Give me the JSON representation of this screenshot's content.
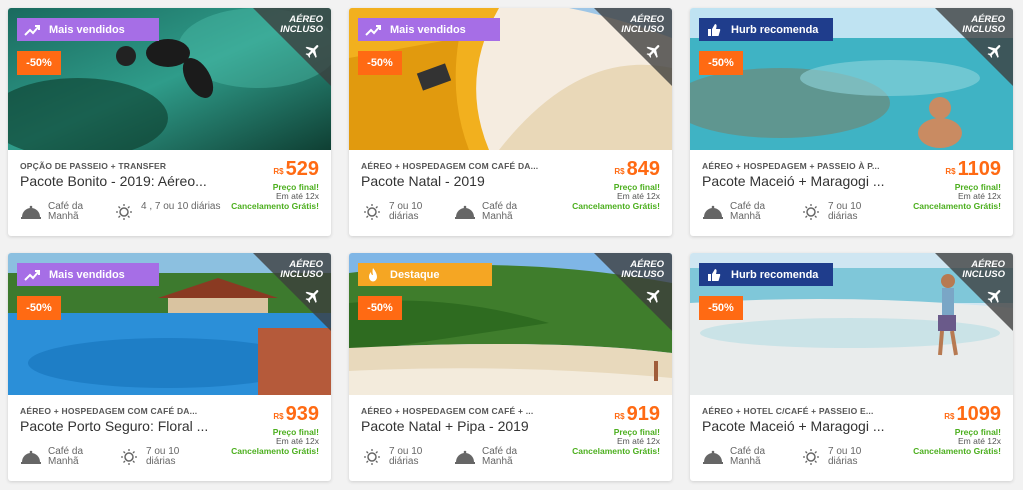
{
  "common": {
    "aereo_line1": "AÉREO",
    "aereo_line2": "INCLUSO",
    "currency": "R$",
    "final_label": "Preço final!",
    "install_label": "Em até 12x",
    "cancel_label": "Cancelamento Grátis!",
    "discount": "-50%",
    "feature_breakfast": "Café da Manhã",
    "colors": {
      "orange": "#ff6a13",
      "green": "#4caf1e",
      "purple": "#a66ee6",
      "navy": "#1f3d8c",
      "yellow": "#f5a623"
    }
  },
  "cards": [
    {
      "tag_label": "Mais vendidos",
      "tag_icon": "trending-up-icon",
      "category": "OPÇÃO DE PASSEIO + TRANSFER",
      "title": "Pacote Bonito - 2019: Aéreo...",
      "price": "529",
      "diarias": "4 , 7 ou 10 diárias"
    },
    {
      "tag_label": "Mais vendidos",
      "tag_icon": "trending-up-icon",
      "category": "AÉREO + HOSPEDAGEM COM CAFÉ DA...",
      "title": "Pacote Natal - 2019",
      "price": "849",
      "diarias": "7 ou 10 diárias"
    },
    {
      "tag_label": "Hurb recomenda",
      "tag_icon": "thumbs-up-icon",
      "category": "AÉREO + HOSPEDAGEM + PASSEIO À P...",
      "title": "Pacote Maceió + Maragogi ...",
      "price": "1109",
      "diarias": "7 ou 10 diárias"
    },
    {
      "tag_label": "Mais vendidos",
      "tag_icon": "trending-up-icon",
      "category": "AÉREO + HOSPEDAGEM COM CAFÉ DA...",
      "title": "Pacote Porto Seguro: Floral ...",
      "price": "939",
      "diarias": "7 ou 10 diárias"
    },
    {
      "tag_label": "Destaque",
      "tag_icon": "flame-icon",
      "category": "AÉREO + HOSPEDAGEM COM CAFÉ + ...",
      "title": "Pacote Natal + Pipa - 2019",
      "price": "919",
      "diarias": "7 ou 10 diárias"
    },
    {
      "tag_label": "Hurb recomenda",
      "tag_icon": "thumbs-up-icon",
      "category": "AÉREO + HOTEL C/CAFÉ + PASSEIO E...",
      "title": "Pacote Maceió + Maragogi ...",
      "price": "1099",
      "diarias": "7 ou 10 diárias"
    }
  ]
}
